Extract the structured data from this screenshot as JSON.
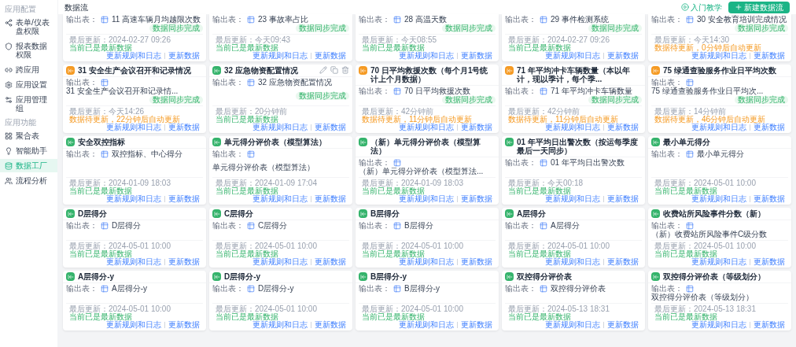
{
  "sidebar": {
    "sections": [
      {
        "title": "应用配置",
        "items": [
          {
            "label": "表单/仪表盘权限",
            "selected": false
          },
          {
            "label": "报表数据权限",
            "selected": false
          },
          {
            "label": "跨应用",
            "selected": false
          },
          {
            "label": "应用设置",
            "selected": false
          },
          {
            "label": "应用管理组",
            "selected": false
          }
        ]
      },
      {
        "title": "应用功能",
        "items": [
          {
            "label": "聚合表",
            "selected": false
          },
          {
            "label": "智能助手",
            "selected": false
          },
          {
            "label": "数据工厂",
            "selected": true
          },
          {
            "label": "流程分析",
            "selected": false
          }
        ]
      }
    ]
  },
  "header": {
    "title": "数据流",
    "help_link": "入门教学",
    "create_button": "新建数据流"
  },
  "cards": [
    {
      "output_label": "输出表：",
      "output": "11 高速车辆月均越限次数",
      "badge": "数据同步完成",
      "updated": "最后更新：2024-02-27 09:26",
      "status": {
        "text": "当前已是最新数据",
        "kind": "ok"
      },
      "actions": [
        "更新规则和日志",
        "更新数据"
      ]
    },
    {
      "output_label": "输出表：",
      "output": "23 事故率占比",
      "badge": "数据同步完成",
      "updated": "最后更新：今天09:43",
      "status": {
        "text": "当前已是最新数据",
        "kind": "ok"
      },
      "actions": [
        "更新规则和日志",
        "更新数据"
      ]
    },
    {
      "output_label": "输出表：",
      "output": "28 高温天数",
      "badge": "数据同步完成",
      "updated": "最后更新：今天08:55",
      "status": {
        "text": "当前已是最新数据",
        "kind": "ok"
      },
      "actions": [
        "更新规则和日志",
        "更新数据"
      ]
    },
    {
      "output_label": "输出表：",
      "output": "29 事件检测系统",
      "badge": "数据同步完成",
      "updated": "最后更新：2024-02-27 09:26",
      "status": {
        "text": "当前已是最新数据",
        "kind": "ok"
      },
      "actions": [
        "更新规则和日志",
        "更新数据"
      ]
    },
    {
      "output_label": "输出表：",
      "output": "30 安全教育培训完成情况",
      "badge": "数据同步完成",
      "updated": "最后更新：今天14:30",
      "status": {
        "text": "数据待更新，0分钟后自动更新",
        "kind": "pending"
      },
      "actions": [
        "更新规则和日志",
        "更新数据"
      ]
    },
    {
      "title": "31 安全生产会议召开和记录情况",
      "color": "#f59a23",
      "hovered": false,
      "output_label": "输出表：",
      "output": "31 安全生产会议召开和记录情...",
      "badge": "数据同步完成",
      "updated": "最后更新：今天14:26",
      "status": {
        "text": "数据待更新，22分钟后自动更新",
        "kind": "pending"
      },
      "actions": [
        "更新规则和日志",
        "更新数据"
      ]
    },
    {
      "title": "32 应急物资配置情况",
      "color": "#34b36b",
      "hovered": true,
      "output_label": "输出表：",
      "output": "32 应急物资配置情况",
      "badge": "数据同步完成",
      "updated": "最后更新：20分钟前",
      "status": {
        "text": "当前已是最新数据",
        "kind": "ok"
      },
      "actions": [
        "更新规则和日志",
        "更新数据"
      ]
    },
    {
      "title": "70 日平均救援次数（每个月1号统计上个月数据）",
      "color": "#f59a23",
      "hovered": false,
      "output_label": "输出表：",
      "output": "70 日平均救援次数",
      "badge": "数据同步完成",
      "updated": "最后更新：42分钟前",
      "status": {
        "text": "数据待更新，11分钟后自动更新",
        "kind": "pending"
      },
      "actions": [
        "更新规则和日志",
        "更新数据"
      ]
    },
    {
      "title": "71 年平均冲卡车辆数量（本以年计，现以季计，每个季...",
      "color": "#f59a23",
      "hovered": false,
      "output_label": "输出表：",
      "output": "71 年平均冲卡车辆数量",
      "badge": "数据同步完成",
      "updated": "最后更新：42分钟前",
      "status": {
        "text": "数据待更新，11分钟后自动更新",
        "kind": "pending"
      },
      "actions": [
        "更新规则和日志",
        "更新数据"
      ]
    },
    {
      "title": "75 绿通查验服务作业日平均次数",
      "color": "#f59a23",
      "hovered": false,
      "output_label": "输出表：",
      "output": "75 绿通查验服务作业日平均次...",
      "badge": "数据同步完成",
      "updated": "最后更新：14分钟前",
      "status": {
        "text": "数据待更新，46分钟后自动更新",
        "kind": "pending"
      },
      "actions": [
        "更新规则和日志",
        "更新数据"
      ]
    },
    {
      "title": "安全双控指标",
      "color": "#34b36b",
      "hovered": false,
      "output_label": "输出表：",
      "output": "双控指标、中心得分",
      "updated": "最后更新：2024-01-09 18:03",
      "status": {
        "text": "当前已是最新数据",
        "kind": "ok"
      },
      "actions": [
        "更新规则和日志",
        "更新数据"
      ]
    },
    {
      "title": "单元得分评价表（模型算法）",
      "color": "#34b36b",
      "hovered": false,
      "output_label": "输出表：",
      "output": "单元得分评价表（模型算法）",
      "updated": "最后更新：2024-01-09 17:04",
      "status": {
        "text": "当前已是最新数据",
        "kind": "ok"
      },
      "actions": [
        "更新规则和日志",
        "更新数据"
      ]
    },
    {
      "title": "（新）单元得分评价表（模型算法）",
      "color": "#34b36b",
      "hovered": false,
      "output_label": "输出表：",
      "output": "（新）单元得分评价表（模型算法...",
      "updated": "最后更新：2024-01-09 18:03",
      "status": {
        "text": "当前已是最新数据",
        "kind": "ok"
      },
      "actions": [
        "更新规则和日志",
        "更新数据"
      ]
    },
    {
      "title": "01 年平均日出警次数（按运每季度最后一天同步）",
      "color": "#34b36b",
      "hovered": false,
      "output_label": "输出表：",
      "output": "01 年平均日出警次数",
      "updated": "最后更新：今天00:18",
      "status": {
        "text": "当前已是最新数据",
        "kind": "ok"
      },
      "actions": [
        "更新规则和日志",
        "更新数据"
      ]
    },
    {
      "title": "最小单元得分",
      "color": "#34b36b",
      "hovered": false,
      "output_label": "输出表：",
      "output": "最小单元得分",
      "updated": "最后更新：2024-05-01 10:00",
      "status": {
        "text": "当前已是最新数据",
        "kind": "ok"
      },
      "actions": [
        "更新规则和日志",
        "更新数据"
      ]
    },
    {
      "title": "D层得分",
      "color": "#34b36b",
      "hovered": false,
      "output_label": "输出表：",
      "output": "D层得分",
      "updated": "最后更新：2024-05-01 10:00",
      "status": {
        "text": "当前已是最新数据",
        "kind": "ok"
      },
      "actions": [
        "更新规则和日志",
        "更新数据"
      ]
    },
    {
      "title": "C层得分",
      "color": "#34b36b",
      "hovered": false,
      "output_label": "输出表：",
      "output": "C层得分",
      "updated": "最后更新：2024-05-01 10:00",
      "status": {
        "text": "当前已是最新数据",
        "kind": "ok"
      },
      "actions": [
        "更新规则和日志",
        "更新数据"
      ]
    },
    {
      "title": "B层得分",
      "color": "#34b36b",
      "hovered": false,
      "output_label": "输出表：",
      "output": "B层得分",
      "updated": "最后更新：2024-05-01 10:00",
      "status": {
        "text": "当前已是最新数据",
        "kind": "ok"
      },
      "actions": [
        "更新规则和日志",
        "更新数据"
      ]
    },
    {
      "title": "A层得分",
      "color": "#34b36b",
      "hovered": false,
      "output_label": "输出表：",
      "output": "A层得分",
      "updated": "最后更新：2024-05-01 10:00",
      "status": {
        "text": "当前已是最新数据",
        "kind": "ok"
      },
      "actions": [
        "更新规则和日志",
        "更新数据"
      ]
    },
    {
      "title": "收费站所风险事件分数（新）",
      "color": "#34b36b",
      "hovered": false,
      "output_label": "输出表：",
      "output": "（新）收费站所风险事件C级分数",
      "updated": "最后更新：2024-05-01 10:00",
      "status": {
        "text": "当前已是最新数据",
        "kind": "ok"
      },
      "actions": [
        "更新规则和日志",
        "更新数据"
      ]
    },
    {
      "title": "A层得分-y",
      "color": "#34b36b",
      "hovered": false,
      "output_label": "输出表：",
      "output": "A层得分-y",
      "updated": "最后更新：2024-05-01 10:00",
      "status": {
        "text": "当前已是最新数据",
        "kind": "ok"
      },
      "actions": [
        "更新规则和日志",
        "更新数据"
      ]
    },
    {
      "title": "D层得分-y",
      "color": "#34b36b",
      "hovered": false,
      "output_label": "输出表：",
      "output": "D层得分-y",
      "updated": "最后更新：2024-05-01 10:00",
      "status": {
        "text": "当前已是最新数据",
        "kind": "ok"
      },
      "actions": [
        "更新规则和日志",
        "更新数据"
      ]
    },
    {
      "title": "B层得分-y",
      "color": "#34b36b",
      "hovered": false,
      "output_label": "输出表：",
      "output": "B层得分-y",
      "updated": "最后更新：2024-05-01 10:00",
      "status": {
        "text": "当前已是最新数据",
        "kind": "ok"
      },
      "actions": [
        "更新规则和日志",
        "更新数据"
      ]
    },
    {
      "title": "双控得分评价表",
      "color": "#34b36b",
      "hovered": false,
      "output_label": "输出表：",
      "output": "双控得分评价表",
      "updated": "最后更新：2024-05-13 18:31",
      "status": {
        "text": "当前已是最新数据",
        "kind": "ok"
      },
      "actions": [
        "更新规则和日志",
        "更新数据"
      ]
    },
    {
      "title": "双控得分评价表（等级划分）",
      "color": "#34b36b",
      "hovered": false,
      "output_label": "输出表：",
      "output": "双控得分评价表（等级划分）",
      "updated": "最后更新：2024-05-13 18:31",
      "status": {
        "text": "当前已是最新数据",
        "kind": "ok"
      },
      "actions": [
        "更新规则和日志",
        "更新数据"
      ]
    }
  ]
}
